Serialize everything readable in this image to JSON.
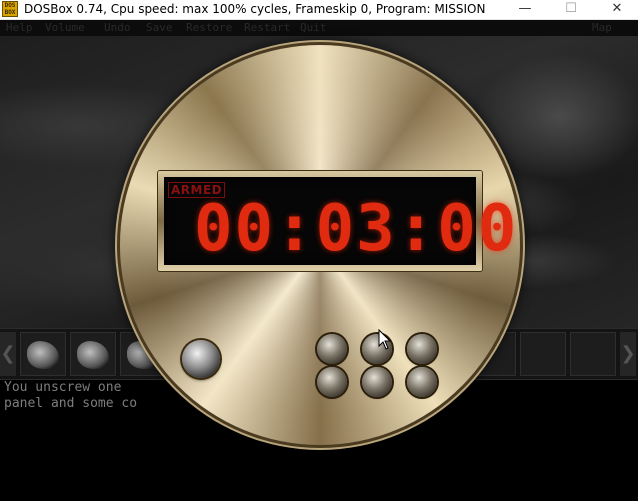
{
  "window": {
    "icon_text": "DOS BOX",
    "title": "DOSBox 0.74, Cpu speed: max 100% cycles, Frameskip  0, Program:  MISSION",
    "min_symbol": "—",
    "max_symbol": "☐",
    "close_symbol": "✕"
  },
  "menu": {
    "items": [
      "Help",
      "Volume",
      "Undo",
      "Save",
      "Restore",
      "Restart",
      "Quit"
    ],
    "right_item": "Map"
  },
  "device": {
    "status_label": "ARMED",
    "time": "00:03:00"
  },
  "inventory": {
    "left_arrow": "❮",
    "right_arrow": "❯"
  },
  "message": {
    "line1": "You unscrew one                         y display",
    "line2": "panel and some co"
  },
  "colors": {
    "digit_red": "#e02b10",
    "armed_red": "#8a1010",
    "brass": "#c8b48a"
  }
}
